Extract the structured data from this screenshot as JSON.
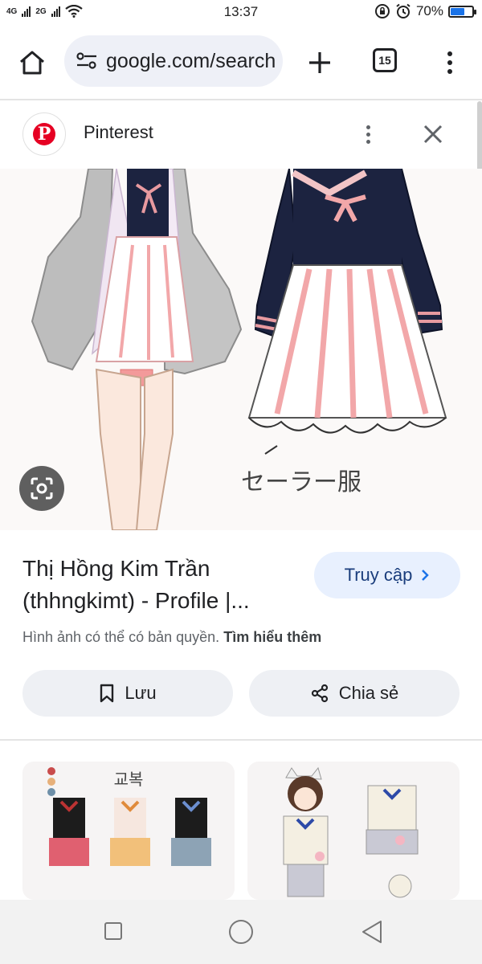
{
  "status_bar": {
    "network_1": "4G",
    "network_2": "2G",
    "time": "13:37",
    "battery_text": "70%",
    "battery_level": 0.7
  },
  "toolbar": {
    "url": "google.com/search",
    "tab_count": "15"
  },
  "panel": {
    "site_name": "Pinterest",
    "title": "Thị Hồng Kim Trần (thhngkimt) - Profile |...",
    "visit_label": "Truy cập",
    "copyright_text": "Hình ảnh có thể có bản quyền.",
    "learn_more": "Tìm hiểu thêm",
    "save_label": "Lưu",
    "share_label": "Chia sẻ"
  },
  "main_image": {
    "handwritten_caption": "セーラー服"
  },
  "related": [
    {
      "caption": "교복"
    },
    {
      "caption": ""
    }
  ],
  "colors": {
    "accent": "#1a73e8",
    "pinterest": "#e60023",
    "navy": "#1c2340",
    "pink": "#f2a7a9"
  }
}
